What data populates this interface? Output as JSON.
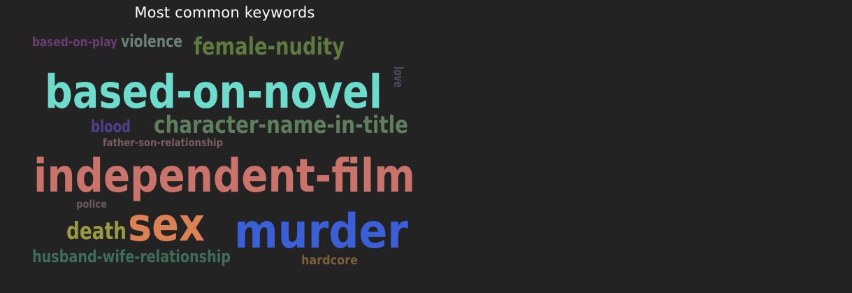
{
  "chart_data": {
    "type": "wordcloud",
    "title": "Most common keywords",
    "words": [
      {
        "text": "independent-film",
        "color": "#c9736a"
      },
      {
        "text": "based-on-novel",
        "color": "#6edccc"
      },
      {
        "text": "murder",
        "color": "#3a5fd6"
      },
      {
        "text": "sex",
        "color": "#dc8154"
      },
      {
        "text": "character-name-in-title",
        "color": "#5e7f5c"
      },
      {
        "text": "female-nudity",
        "color": "#5f7a3e"
      },
      {
        "text": "death",
        "color": "#9a9a43"
      },
      {
        "text": "husband-wife-relationship",
        "color": "#3e6d5c"
      },
      {
        "text": "violence",
        "color": "#6c8079"
      },
      {
        "text": "based-on-play",
        "color": "#6c3d74"
      },
      {
        "text": "blood",
        "color": "#523f8c"
      },
      {
        "text": "hardcore",
        "color": "#7a5f3d"
      },
      {
        "text": "father-son-relationship",
        "color": "#7c5e5e"
      },
      {
        "text": "police",
        "color": "#6c5760"
      },
      {
        "text": "love",
        "color": "#4f4a60"
      }
    ]
  }
}
